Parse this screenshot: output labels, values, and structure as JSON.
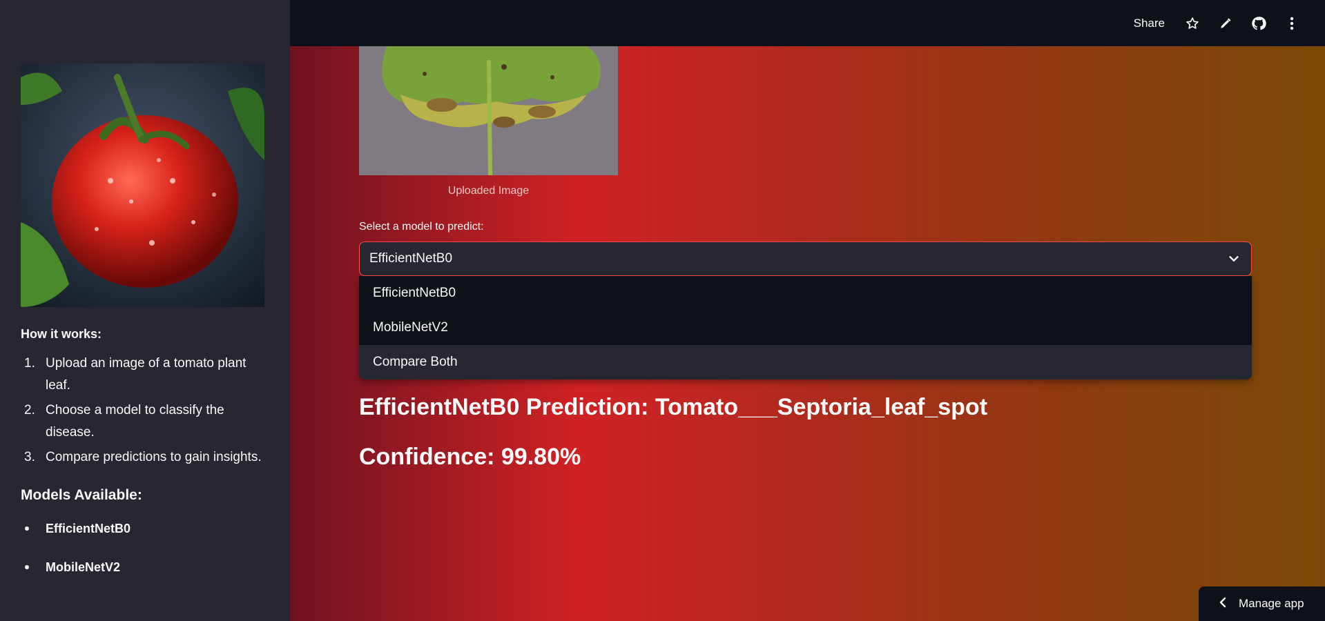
{
  "header": {
    "share_label": "Share",
    "icons": [
      "star-icon",
      "pencil-icon",
      "github-icon",
      "kebab-menu-icon"
    ]
  },
  "sidebar": {
    "how_heading": "How it works:",
    "steps": [
      {
        "num": "1.",
        "text": "Upload an image of a tomato plant leaf."
      },
      {
        "num": "2.",
        "text": "Choose a model to classify the disease."
      },
      {
        "num": "3.",
        "text": "Compare predictions to gain insights."
      }
    ],
    "models_heading": "Models Available:",
    "models": [
      "EfficientNetB0",
      "MobileNetV2"
    ]
  },
  "main": {
    "image_caption": "Uploaded Image",
    "select_label": "Select a model to predict:",
    "selected_value": "EfficientNetB0",
    "options": [
      "EfficientNetB0",
      "MobileNetV2",
      "Compare Both"
    ],
    "highlighted_option": "Compare Both",
    "prediction_text": "EfficientNetB0 Prediction: Tomato___Septoria_leaf_spot",
    "confidence_text": "Confidence: 99.80%"
  },
  "footer": {
    "manage_app_label": "Manage app"
  },
  "colors": {
    "sidebar_bg": "#262730",
    "header_bg": "#0e1117",
    "select_border": "#ff4b4b",
    "gradient_start": "#6e1220",
    "gradient_mid": "#d02224",
    "gradient_end": "#7a4a06"
  }
}
